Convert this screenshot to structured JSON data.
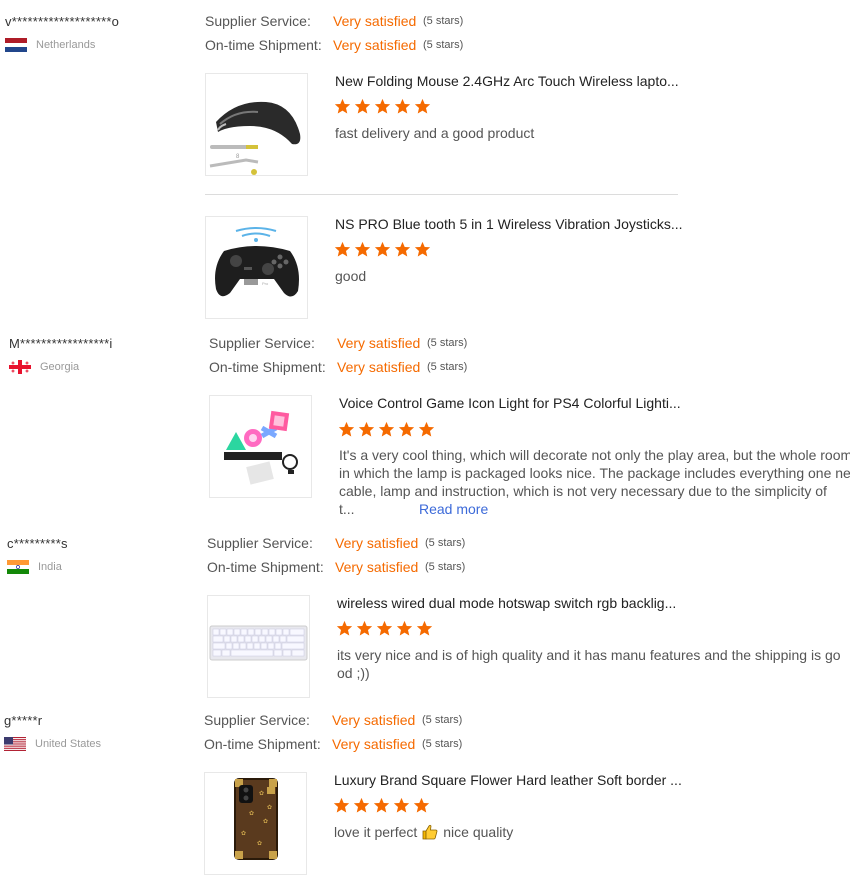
{
  "labels": {
    "supplier": "Supplier Service:",
    "shipment": "On-time Shipment:",
    "satisfied": "Very satisfied",
    "five_stars": "(5 stars)",
    "read_more": "Read more"
  },
  "colors": {
    "accent": "#f56a00",
    "link": "#3c6ad9"
  },
  "reviews": [
    {
      "user": "v*******************o",
      "country": "Netherlands",
      "flag": "netherlands-flag-icon",
      "items": [
        {
          "title": "New Folding Mouse 2.4GHz Arc Touch Wireless lapto...",
          "rating": 5,
          "text": "fast delivery and a good product"
        },
        {
          "title": "NS PRO Blue tooth 5 in 1 Wireless Vibration Joysticks...",
          "rating": 5,
          "text": "good"
        }
      ]
    },
    {
      "user": "M*****************i",
      "country": "Georgia",
      "flag": "georgia-flag-icon",
      "items": [
        {
          "title": "Voice Control Game Icon Light for PS4 Colorful Lighti...",
          "rating": 5,
          "text_lines": [
            "It's a very cool thing, which will decorate not only the play area, but the whole room. The box",
            "in which the lamp is packaged looks nice. The package includes everything one needs: a",
            "cable, lamp and instruction, which is not very necessary due to the simplicity of",
            "t..."
          ]
        }
      ]
    },
    {
      "user": "c*********s",
      "country": "India",
      "flag": "india-flag-icon",
      "items": [
        {
          "title": "wireless wired dual mode hotswap switch rgb backlig...",
          "rating": 5,
          "text_lines": [
            "its very nice and is of high quality and it has manu features and the shipping is go",
            "od ;))"
          ]
        }
      ]
    },
    {
      "user": "g*****r",
      "country": "United States",
      "flag": "usa-flag-icon",
      "items": [
        {
          "title": "Luxury Brand Square Flower Hard leather Soft border ...",
          "rating": 5,
          "text_a": "love it perfect",
          "text_b": "nice quality"
        }
      ]
    }
  ]
}
